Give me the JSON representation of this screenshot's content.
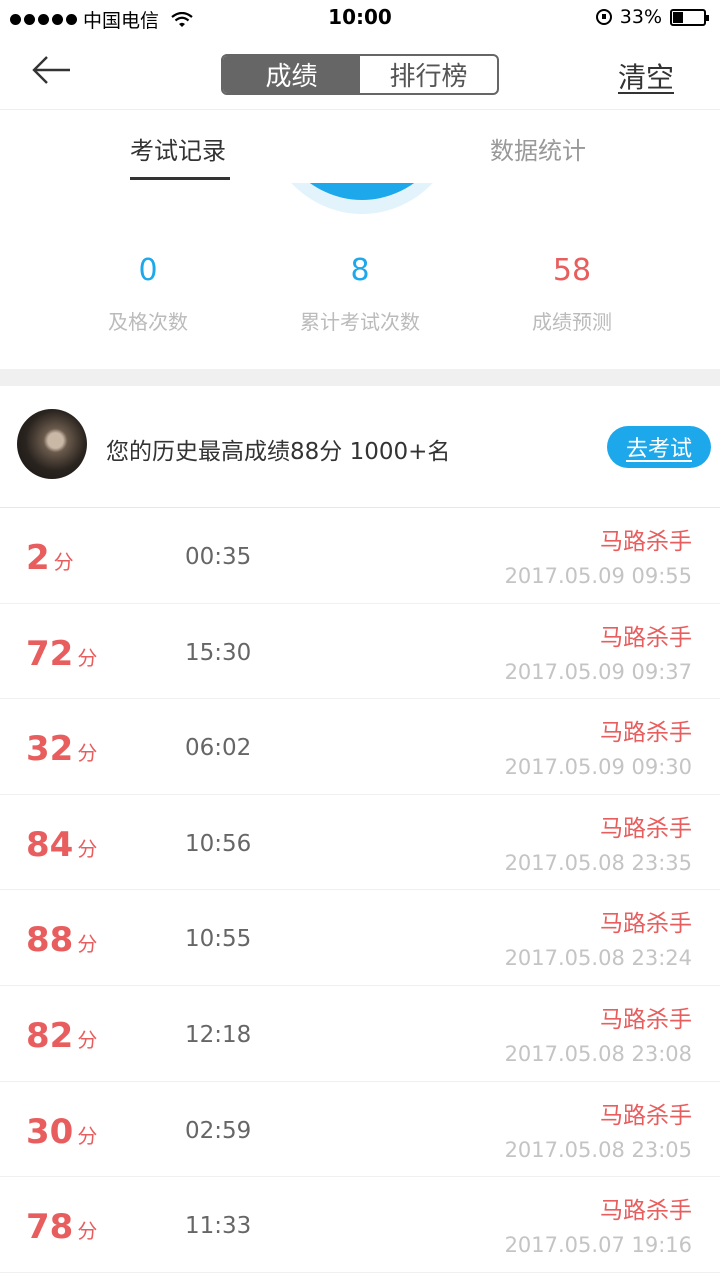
{
  "status_bar": {
    "carrier": "中国电信",
    "time": "10:00",
    "battery_percent": "33%",
    "battery_level": 0.33
  },
  "nav": {
    "segments": [
      "成绩",
      "排行榜"
    ],
    "active_segment": 0,
    "clear_label": "清空"
  },
  "tabs": {
    "items": [
      "考试记录",
      "数据统计"
    ],
    "active": 0
  },
  "stats": [
    {
      "value": "0",
      "label": "及格次数",
      "color": "#1ea8ec"
    },
    {
      "value": "8",
      "label": "累计考试次数",
      "color": "#1ea8ec"
    },
    {
      "value": "58",
      "label": "成绩预测",
      "color": "#e85d5d"
    }
  ],
  "best": {
    "text": "您的历史最高成绩88分 1000+名",
    "button_label": "去考试"
  },
  "records": [
    {
      "score": "2",
      "unit": "分",
      "duration": "00:35",
      "title": "马路杀手",
      "date": "2017.05.09 09:55"
    },
    {
      "score": "72",
      "unit": "分",
      "duration": "15:30",
      "title": "马路杀手",
      "date": "2017.05.09 09:37"
    },
    {
      "score": "32",
      "unit": "分",
      "duration": "06:02",
      "title": "马路杀手",
      "date": "2017.05.09 09:30"
    },
    {
      "score": "84",
      "unit": "分",
      "duration": "10:56",
      "title": "马路杀手",
      "date": "2017.05.08 23:35"
    },
    {
      "score": "88",
      "unit": "分",
      "duration": "10:55",
      "title": "马路杀手",
      "date": "2017.05.08 23:24"
    },
    {
      "score": "82",
      "unit": "分",
      "duration": "12:18",
      "title": "马路杀手",
      "date": "2017.05.08 23:08"
    },
    {
      "score": "30",
      "unit": "分",
      "duration": "02:59",
      "title": "马路杀手",
      "date": "2017.05.08 23:05"
    },
    {
      "score": "78",
      "unit": "分",
      "duration": "11:33",
      "title": "马路杀手",
      "date": "2017.05.07 19:16"
    }
  ],
  "colors": {
    "accent_blue": "#1ea8ec",
    "score_red": "#e85d5d",
    "segment_active": "#666666"
  }
}
